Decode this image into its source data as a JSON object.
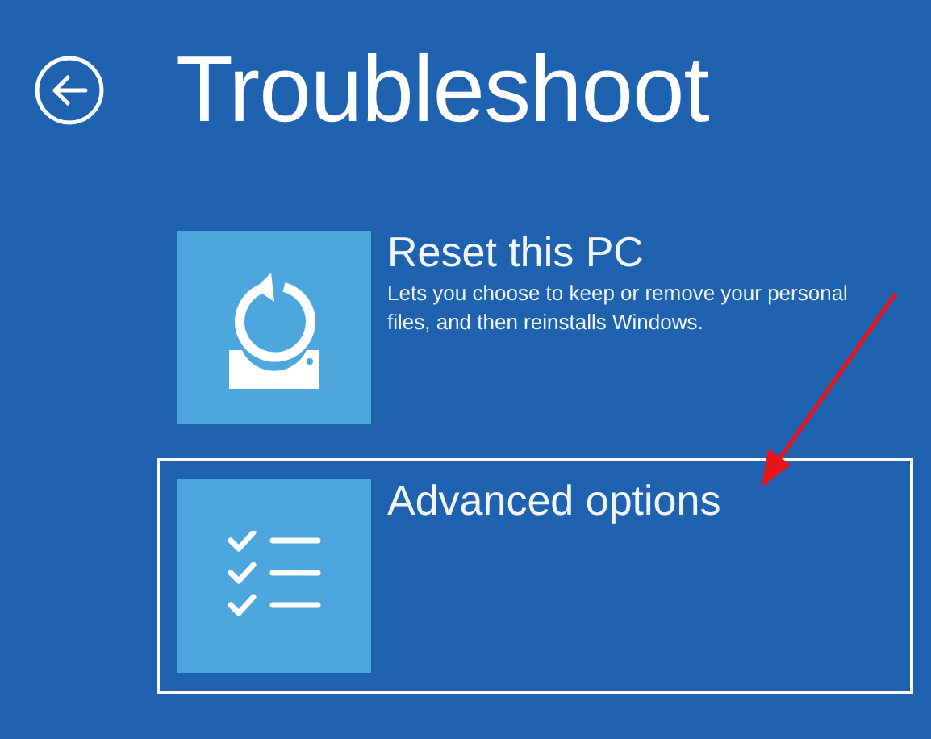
{
  "header": {
    "title": "Troubleshoot"
  },
  "options": [
    {
      "kind": "reset",
      "title": "Reset this PC",
      "description": "Lets you choose to keep or remove your personal files, and then reinstalls Windows.",
      "selected": false
    },
    {
      "kind": "checklist",
      "title": "Advanced options",
      "selected": true
    }
  ]
}
